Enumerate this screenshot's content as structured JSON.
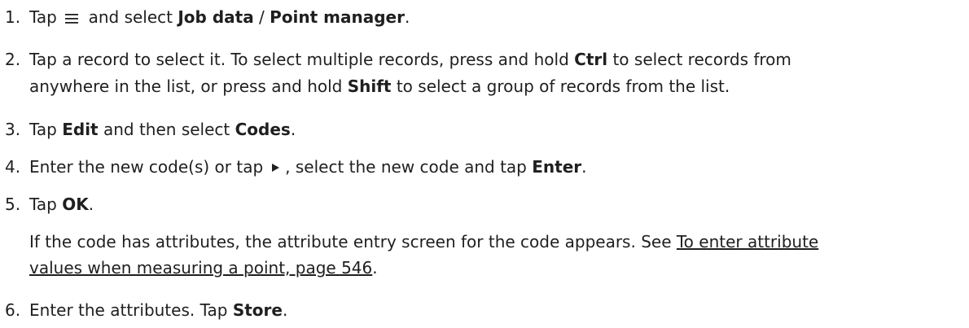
{
  "steps": [
    {
      "number": "1.",
      "t1": "Tap",
      "t2": "and select",
      "b1": "Job data",
      "sep": " / ",
      "b2": "Point manager",
      "end": "."
    },
    {
      "number": "2.",
      "line1_a": "Tap a record to select it. To select multiple records, press and hold ",
      "line1_b": "Ctrl",
      "line1_c": " to select records from",
      "line2_a": "anywhere in the list, or press and hold ",
      "line2_b": "Shift",
      "line2_c": " to select a group of records from the list."
    },
    {
      "number": "3.",
      "t1": "Tap ",
      "b1": "Edit",
      "t2": " and then select ",
      "b2": "Codes",
      "end": "."
    },
    {
      "number": "4.",
      "t1": "Enter the new code(s) or tap",
      "t2": ", select the new code and tap ",
      "b1": "Enter",
      "end": "."
    },
    {
      "number": "5.",
      "t1": "Tap ",
      "b1": "OK",
      "end": "."
    },
    {
      "number": "6.",
      "t1": "Enter the attributes. Tap ",
      "b1": "Store",
      "end": "."
    }
  ],
  "note": {
    "line1_text": "If the code has attributes, the attribute entry screen for the code appears. See ",
    "line1_link": "To enter attribute",
    "line2_link": "values when measuring a point, page 546",
    "line2_end": "."
  },
  "icons": {
    "menu": "hamburger-menu-icon",
    "play": "play-arrow-icon"
  }
}
